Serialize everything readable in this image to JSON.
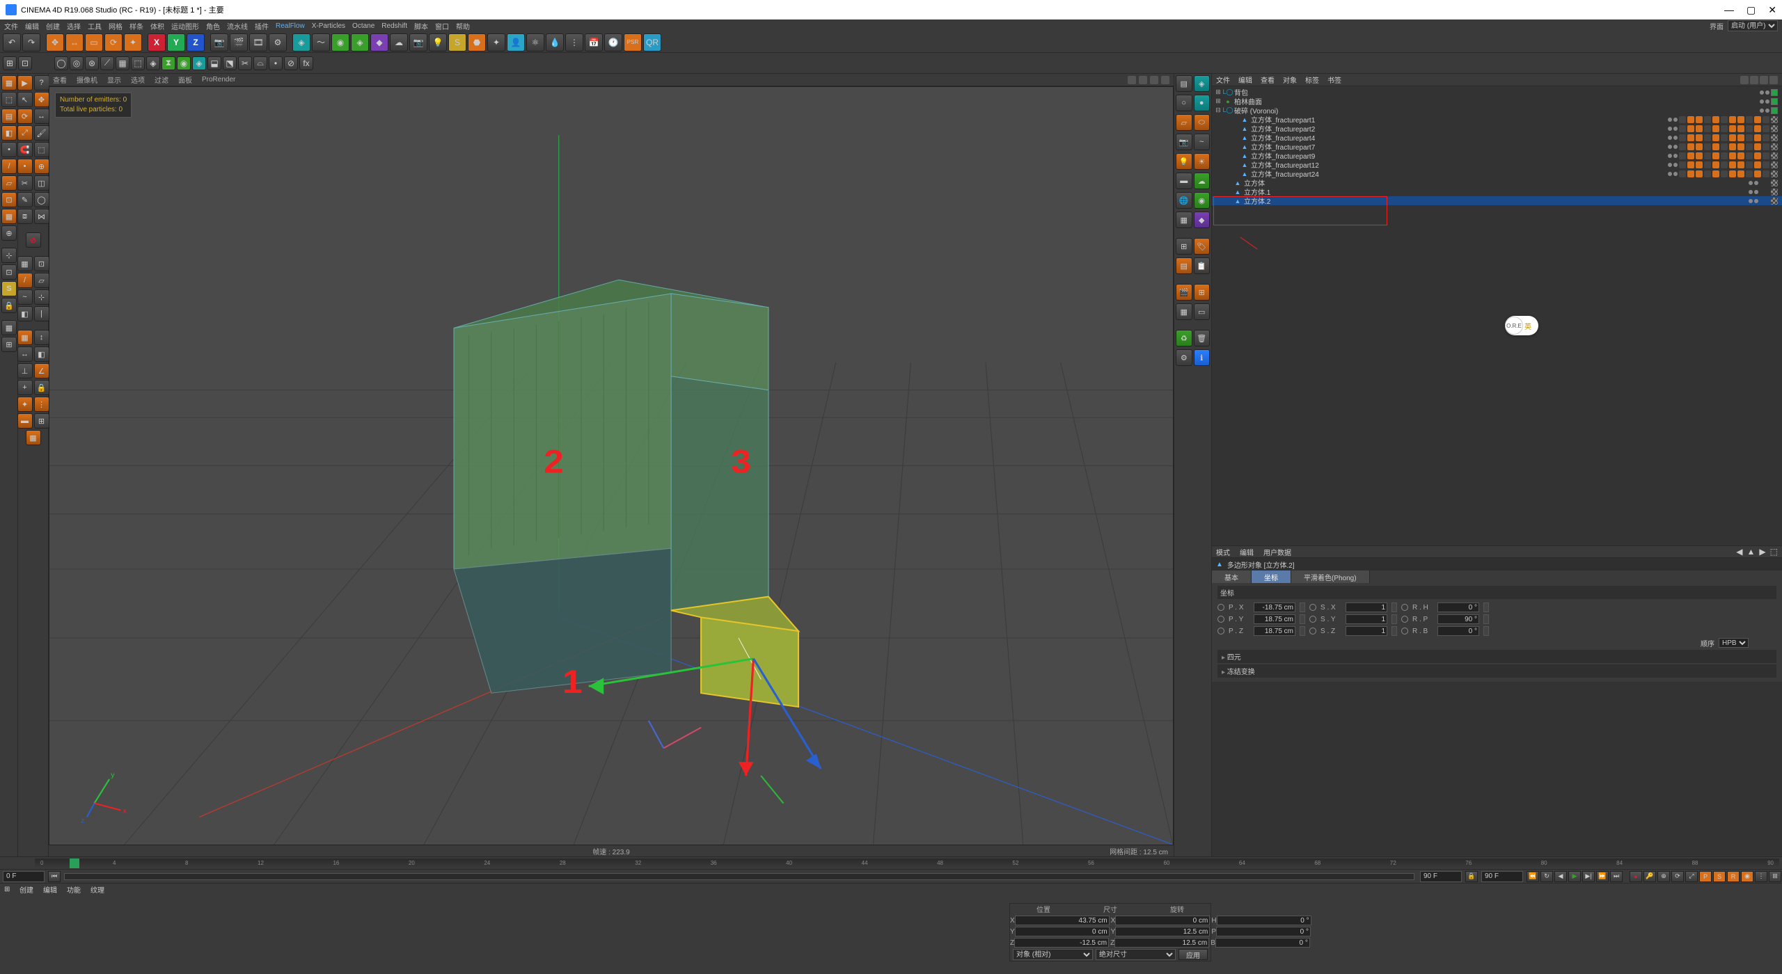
{
  "title": "CINEMA 4D R19.068 Studio (RC - R19) - [未标题 1 *] - 主要",
  "menu": [
    "文件",
    "编辑",
    "创建",
    "选择",
    "工具",
    "网格",
    "样条",
    "体积",
    "运动图形",
    "角色",
    "流水线",
    "插件",
    "RealFlow",
    "X-Particles",
    "Octane",
    "Redshift",
    "脚本",
    "窗口",
    "帮助"
  ],
  "menubar_right": {
    "label": "界面",
    "value": "启动 (用户)"
  },
  "axis": {
    "x": "X",
    "y": "Y",
    "z": "Z"
  },
  "psr": "PSR",
  "viewport_menu": [
    "查看",
    "摄像机",
    "显示",
    "选项",
    "过滤",
    "面板",
    "ProRender"
  ],
  "info": {
    "emitters": "Number of emitters: 0",
    "particles": "Total live particles: 0"
  },
  "annot": {
    "a": "1",
    "b": "2",
    "c": "3"
  },
  "vp_footer": {
    "center": "帧速 : 223.9",
    "right": "网格间距 : 12.5 cm"
  },
  "om_menu": [
    "文件",
    "编辑",
    "查看",
    "对象",
    "标签",
    "书签"
  ],
  "tree": {
    "r0": {
      "exp": "⊞",
      "name": "背包"
    },
    "r1": {
      "exp": "⊞",
      "name": "柏林曲面"
    },
    "r2": {
      "exp": "⊟",
      "name": "破碎  (Voronoi)"
    },
    "parts": [
      "立方体_fracturepart1",
      "立方体_fracturepart2",
      "立方体_fracturepart4",
      "立方体_fracturepart7",
      "立方体_fracturepart9",
      "立方体_fracturepart12",
      "立方体_fracturepart24"
    ],
    "cube0": "立方体",
    "cube1": "立方体.1",
    "cube2": "立方体.2"
  },
  "badge": {
    "icon": "O.R.E",
    "lbl": "英"
  },
  "attr_menu": [
    "模式",
    "编辑",
    "用户数据"
  ],
  "attr_obj": "多边形对象 [立方体.2]",
  "attr_tabs": [
    "基本",
    "坐标",
    "平滑着色(Phong)"
  ],
  "attr_tab_active": 1,
  "coords_section": "坐标",
  "transform": {
    "p": {
      "x": "-18.75 cm",
      "y": "18.75 cm",
      "z": "18.75 cm"
    },
    "s": {
      "x": "1",
      "y": "1",
      "z": "1"
    },
    "r": {
      "h": "0 °",
      "p": "90 °",
      "b": "0 °"
    },
    "order_label": "顺序",
    "order": "HPB"
  },
  "attr_collapse": [
    "四元",
    "冻结变换"
  ],
  "transform_labels": {
    "px": "P . X",
    "py": "P . Y",
    "pz": "P . Z",
    "sx": "S . X",
    "sy": "S . Y",
    "sz": "S . Z",
    "rh": "R . H",
    "rp": "R . P",
    "rb": "R . B"
  },
  "timeline": {
    "start": 0,
    "end": 90,
    "frame_in": "0 F",
    "frame_out_a": "90 F",
    "frame_out_b": "90 F"
  },
  "ticks": [
    "0",
    "4",
    "8",
    "12",
    "16",
    "20",
    "24",
    "28",
    "32",
    "36",
    "40",
    "44",
    "48",
    "52",
    "56",
    "60",
    "64",
    "68",
    "72",
    "76",
    "80",
    "84",
    "88",
    "90"
  ],
  "status_tabs": [
    "创建",
    "编辑",
    "功能",
    "纹理"
  ],
  "coord_panel": {
    "cols": [
      "位置",
      "尺寸",
      "旋转"
    ],
    "x": {
      "l": "X",
      "p": "43.75 cm",
      "s": "0 cm",
      "r": "0 °"
    },
    "y": {
      "l": "Y",
      "p": "0 cm",
      "s": "12.5 cm",
      "r": "0 °"
    },
    "z": {
      "l": "Z",
      "p": "-12.5 cm",
      "s": "12.5 cm",
      "r": "0 °"
    },
    "mode": "对象 (相对)",
    "mode2": "绝对尺寸",
    "apply": "应用"
  },
  "sprefix": {
    "sx": "X",
    "sy": "Y",
    "sz": "Z",
    "rh": "H",
    "rp": "P",
    "rb": "B"
  }
}
